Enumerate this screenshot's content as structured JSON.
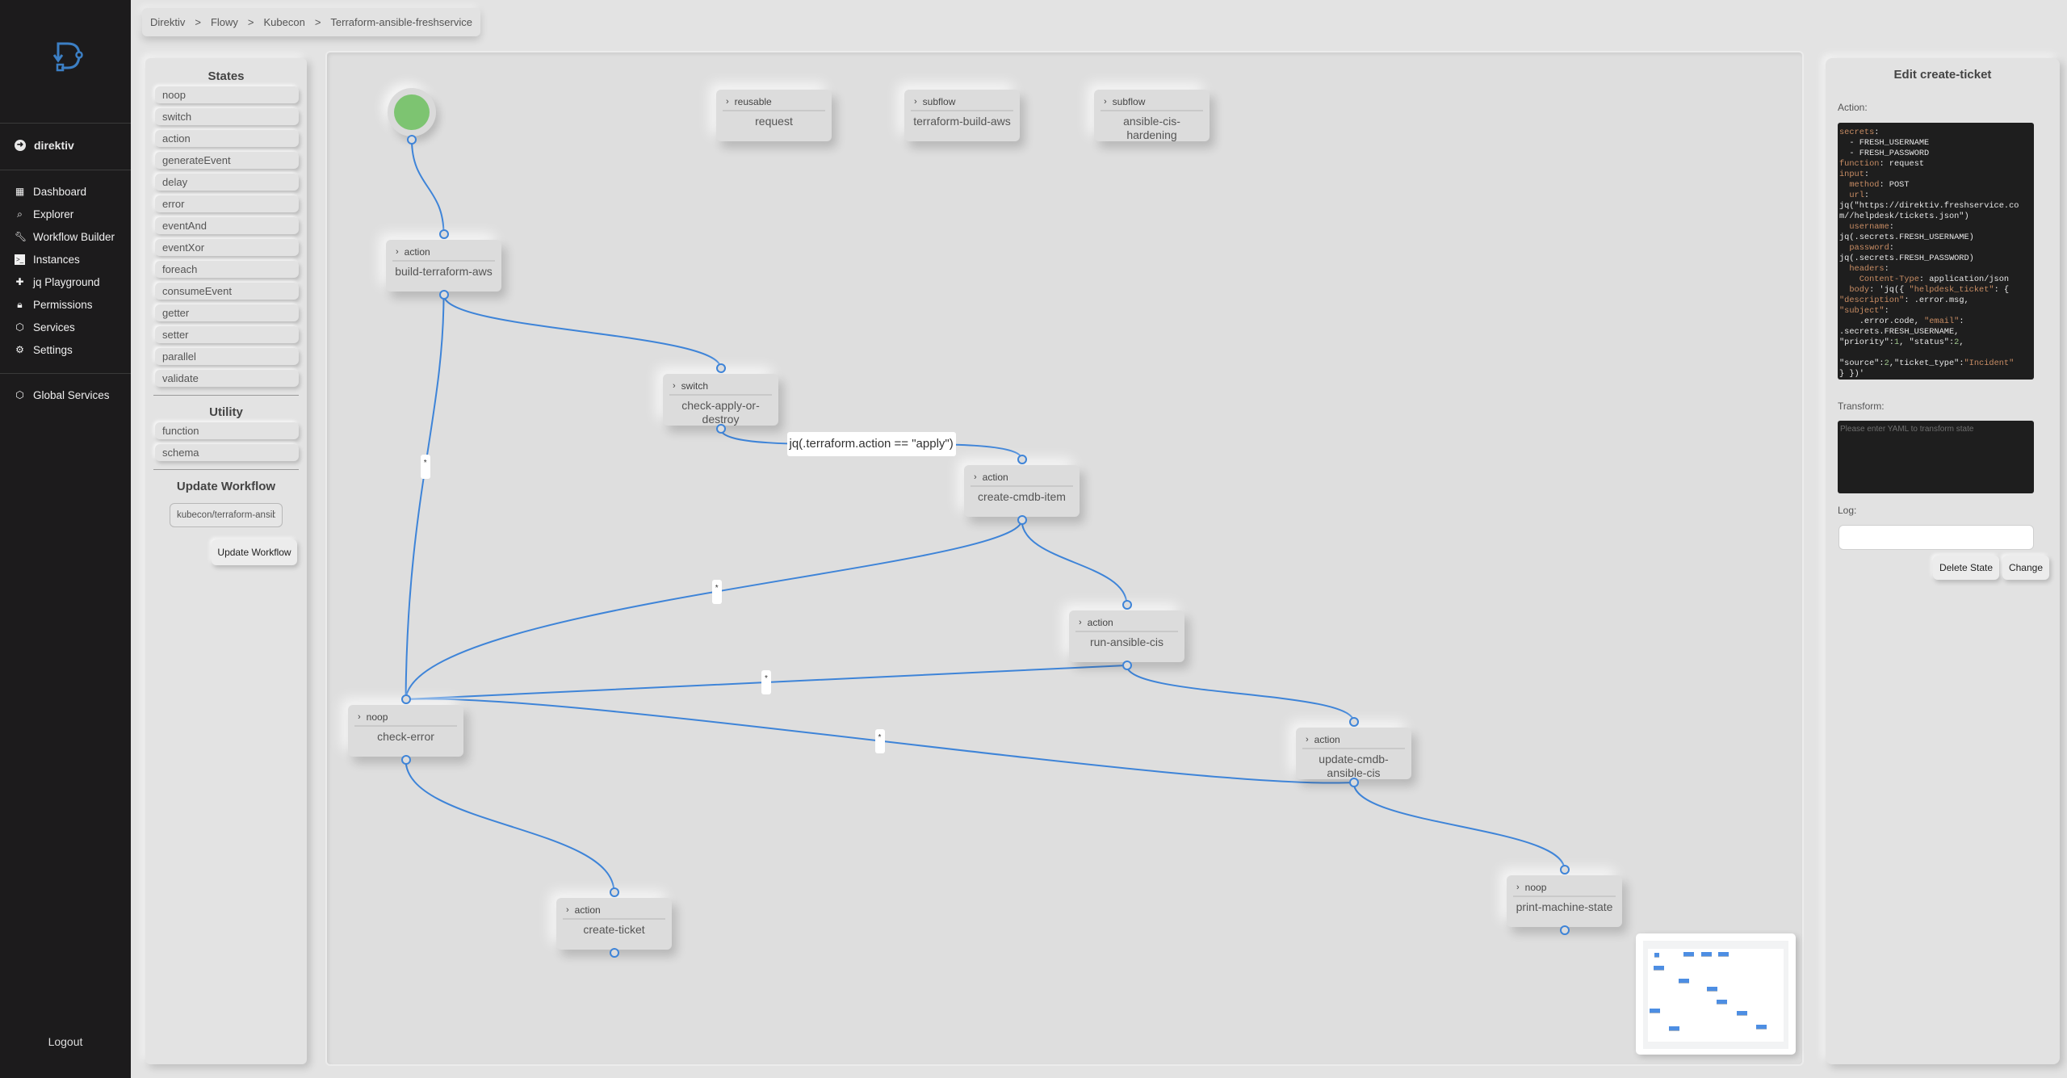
{
  "nav": {
    "namespace": "direktiv",
    "items": [
      {
        "label": "Dashboard",
        "icon": "dashboard-icon"
      },
      {
        "label": "Explorer",
        "icon": "search-icon"
      },
      {
        "label": "Workflow Builder",
        "icon": "wrench-icon"
      },
      {
        "label": "Instances",
        "icon": "terminal-icon"
      },
      {
        "label": "jq Playground",
        "icon": "puzzle-icon"
      },
      {
        "label": "Permissions",
        "icon": "lock-icon"
      },
      {
        "label": "Services",
        "icon": "cube-icon"
      },
      {
        "label": "Settings",
        "icon": "gear-icon"
      }
    ],
    "global_services": "Global Services",
    "logout": "Logout"
  },
  "breadcrumb": [
    "Direktiv",
    "Flowy",
    "Kubecon",
    "Terraform-ansible-freshservice"
  ],
  "breadcrumb_sep": ">",
  "palette": {
    "states_title": "States",
    "states": [
      "noop",
      "switch",
      "action",
      "generateEvent",
      "delay",
      "error",
      "eventAnd",
      "eventXor",
      "foreach",
      "consumeEvent",
      "getter",
      "setter",
      "parallel",
      "validate"
    ],
    "utility_title": "Utility",
    "utility": [
      "function",
      "schema"
    ],
    "update_title": "Update Workflow",
    "workflow_path": "kubecon/terraform-ansible-freshservice",
    "update_button": "Update Workflow"
  },
  "graph": {
    "start": {
      "label": "start"
    },
    "nodes": [
      {
        "id": "request",
        "type": "reusable",
        "name": "request"
      },
      {
        "id": "terraform-build-aws",
        "type": "subflow",
        "name": "terraform-build-aws"
      },
      {
        "id": "ansible-cis-hardening",
        "type": "subflow",
        "name": "ansible-cis-hardening"
      },
      {
        "id": "build-terraform-aws",
        "type": "action",
        "name": "build-terraform-aws"
      },
      {
        "id": "check-apply-or-destroy",
        "type": "switch",
        "name": "check-apply-or-destroy"
      },
      {
        "id": "create-cmdb-item",
        "type": "action",
        "name": "create-cmdb-item"
      },
      {
        "id": "run-ansible-cis",
        "type": "action",
        "name": "run-ansible-cis"
      },
      {
        "id": "check-error",
        "type": "noop",
        "name": "check-error"
      },
      {
        "id": "update-cmdb-ansible-cis",
        "type": "action",
        "name": "update-cmdb-ansible-cis"
      },
      {
        "id": "create-ticket",
        "type": "action",
        "name": "create-ticket"
      },
      {
        "id": "print-machine-state",
        "type": "noop",
        "name": "print-machine-state"
      }
    ],
    "edges": [
      {
        "from": "start",
        "to": "build-terraform-aws",
        "label": ""
      },
      {
        "from": "build-terraform-aws",
        "to": "check-apply-or-destroy",
        "label": ""
      },
      {
        "from": "build-terraform-aws",
        "to": "check-error",
        "label": "*"
      },
      {
        "from": "check-apply-or-destroy",
        "to": "create-cmdb-item",
        "label": "jq(.terraform.action == \"apply\")"
      },
      {
        "from": "create-cmdb-item",
        "to": "run-ansible-cis",
        "label": ""
      },
      {
        "from": "create-cmdb-item",
        "to": "check-error",
        "label": "*"
      },
      {
        "from": "run-ansible-cis",
        "to": "update-cmdb-ansible-cis",
        "label": ""
      },
      {
        "from": "run-ansible-cis",
        "to": "check-error",
        "label": "*"
      },
      {
        "from": "update-cmdb-ansible-cis",
        "to": "check-error",
        "label": "*"
      },
      {
        "from": "update-cmdb-ansible-cis",
        "to": "print-machine-state",
        "label": ""
      },
      {
        "from": "check-error",
        "to": "create-ticket",
        "label": ""
      }
    ]
  },
  "editor": {
    "title": "Edit create-ticket",
    "action_label": "Action:",
    "action_yaml": [
      [
        [
          "k",
          "secrets"
        ],
        [
          "t",
          ":"
        ]
      ],
      [
        [
          "t",
          "  - FRESH_USERNAME"
        ]
      ],
      [
        [
          "t",
          "  - FRESH_PASSWORD"
        ]
      ],
      [
        [
          "k",
          "function"
        ],
        [
          "t",
          ": request"
        ]
      ],
      [
        [
          "k",
          "input"
        ],
        [
          "t",
          ":"
        ]
      ],
      [
        [
          "k",
          "  method"
        ],
        [
          "t",
          ": POST"
        ]
      ],
      [
        [
          "k",
          "  url"
        ],
        [
          "t",
          ":"
        ]
      ],
      [
        [
          "t",
          "jq(\"https://direktiv.freshservice.com//helpdesk/tickets.json\")"
        ]
      ],
      [
        [
          "k",
          "  username"
        ],
        [
          "t",
          ":"
        ]
      ],
      [
        [
          "t",
          "jq(.secrets.FRESH_USERNAME)"
        ]
      ],
      [
        [
          "k",
          "  password"
        ],
        [
          "t",
          ":"
        ]
      ],
      [
        [
          "t",
          "jq(.secrets.FRESH_PASSWORD)"
        ]
      ],
      [
        [
          "k",
          "  headers"
        ],
        [
          "t",
          ":"
        ]
      ],
      [
        [
          "k",
          "    Content-Type"
        ],
        [
          "t",
          ": application/json"
        ]
      ],
      [
        [
          "k",
          "  body"
        ],
        [
          "t",
          ": 'jq({ "
        ],
        [
          "s",
          "\"helpdesk_ticket\""
        ],
        [
          "t",
          ": {"
        ]
      ],
      [
        [
          "s",
          "\"description\""
        ],
        [
          "t",
          ": .error.msg,"
        ]
      ],
      [
        [
          "s",
          "\"subject\""
        ],
        [
          "t",
          ":"
        ]
      ],
      [
        [
          "t",
          "    .error.code, "
        ],
        [
          "s",
          "\"email\""
        ],
        [
          "t",
          ":"
        ]
      ],
      [
        [
          "t",
          ".secrets.FRESH_USERNAME,"
        ]
      ],
      [
        [
          "t",
          "\"priority\":"
        ],
        [
          "n",
          "1"
        ],
        [
          "t",
          ", \"status\":"
        ],
        [
          "n",
          "2"
        ],
        [
          "t",
          ","
        ]
      ],
      [
        [
          "t",
          ""
        ]
      ],
      [
        [
          "t",
          "\"source\":"
        ],
        [
          "n",
          "2"
        ],
        [
          "t",
          ",\"ticket_type\":"
        ],
        [
          "s",
          "\"Incident\""
        ]
      ],
      [
        [
          "t",
          "} })'"
        ]
      ]
    ],
    "transform_label": "Transform:",
    "transform_placeholder": "Please enter YAML to transform state",
    "transform_value": "",
    "log_label": "Log:",
    "log_value": "",
    "delete_button": "Delete State",
    "change_button": "Change"
  },
  "colors": {
    "accent": "#3e84d8",
    "start_node": "#7dc471",
    "sidebar_bg": "#1c1b1c",
    "code_bg": "#1e1e1e",
    "code_key": "#c98d64",
    "code_number": "#9cc38a"
  }
}
